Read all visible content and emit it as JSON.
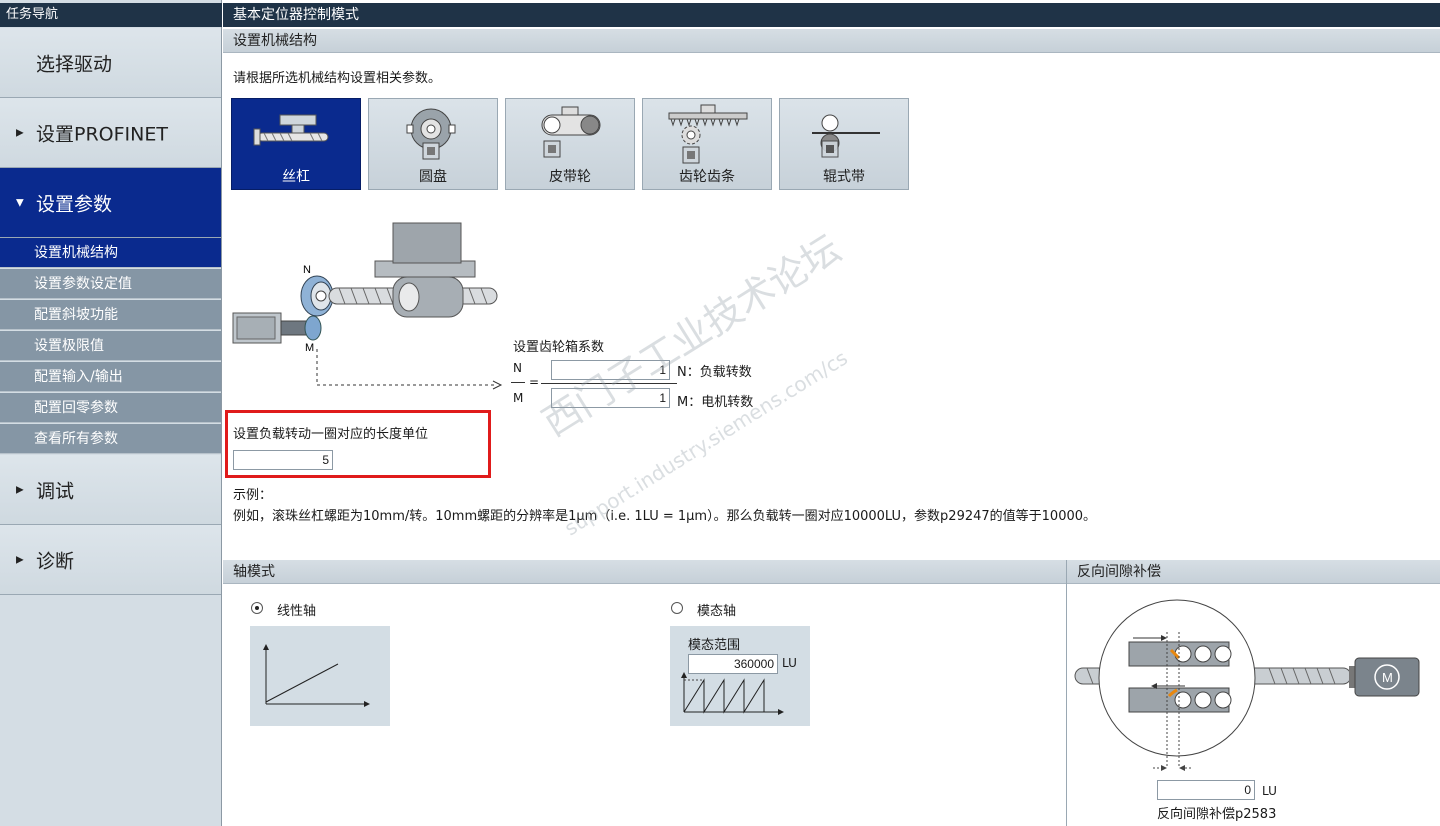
{
  "nav": {
    "title": "任务导航",
    "big_items": [
      {
        "label": "选择驱动"
      },
      {
        "label": "设置PROFINET"
      },
      {
        "label": "设置参数"
      },
      {
        "label": "调试"
      },
      {
        "label": "诊断"
      }
    ],
    "sub_items": [
      {
        "label": "设置机械结构"
      },
      {
        "label": "设置参数设定值"
      },
      {
        "label": "配置斜坡功能"
      },
      {
        "label": "设置极限值"
      },
      {
        "label": "配置输入/输出"
      },
      {
        "label": "配置回零参数"
      },
      {
        "label": "查看所有参数"
      }
    ]
  },
  "header": {
    "title": "基本定位器控制模式"
  },
  "mechanics": {
    "section_title": "设置机械结构",
    "instruction": "请根据所选机械结构设置相关参数。",
    "types": [
      {
        "label": "丝杠",
        "icon": "ball-screw-icon"
      },
      {
        "label": "圆盘",
        "icon": "rotary-table-icon"
      },
      {
        "label": "皮带轮",
        "icon": "belt-pulley-icon"
      },
      {
        "label": "齿轮齿条",
        "icon": "rack-pinion-icon"
      },
      {
        "label": "辊式带",
        "icon": "roller-belt-icon"
      }
    ],
    "selected": "丝杠",
    "diagram_labels": {
      "n": "N",
      "m": "M"
    }
  },
  "gearbox": {
    "title": "设置齿轮箱系数",
    "n_symbol": "N",
    "m_symbol": "M",
    "equals": "=",
    "n_value": "1",
    "m_value": "1",
    "n_desc": "N：负载转数",
    "m_desc": "M：电机转数"
  },
  "length_unit": {
    "label": "设置负载转动一圈对应的长度单位",
    "value": "5"
  },
  "example": {
    "title": "示例：",
    "text": "例如，滚珠丝杠螺距为10mm/转。10mm螺距的分辨率是1μm（i.e. 1LU = 1μm）。那么负载转一圈对应10000LU，参数p29247的值等于10000。"
  },
  "axis_mode": {
    "section_title": "轴模式",
    "linear_label": "线性轴",
    "modulo_label": "模态轴",
    "selected": "线性轴",
    "modulo_range_label": "模态范围",
    "modulo_range_value": "360000",
    "modulo_unit": "LU"
  },
  "backlash": {
    "section_title": "反向间隙补偿",
    "value": "0",
    "unit": "LU",
    "caption": "反向间隙补偿p2583",
    "motor_symbol": "M"
  },
  "watermark": {
    "line1": "西门子工业技术论坛",
    "line2": "support.industry.siemens.com/cs"
  },
  "colors": {
    "active": "#0a2a8e",
    "header": "#1f3347",
    "highlight": "#e01b1b"
  }
}
